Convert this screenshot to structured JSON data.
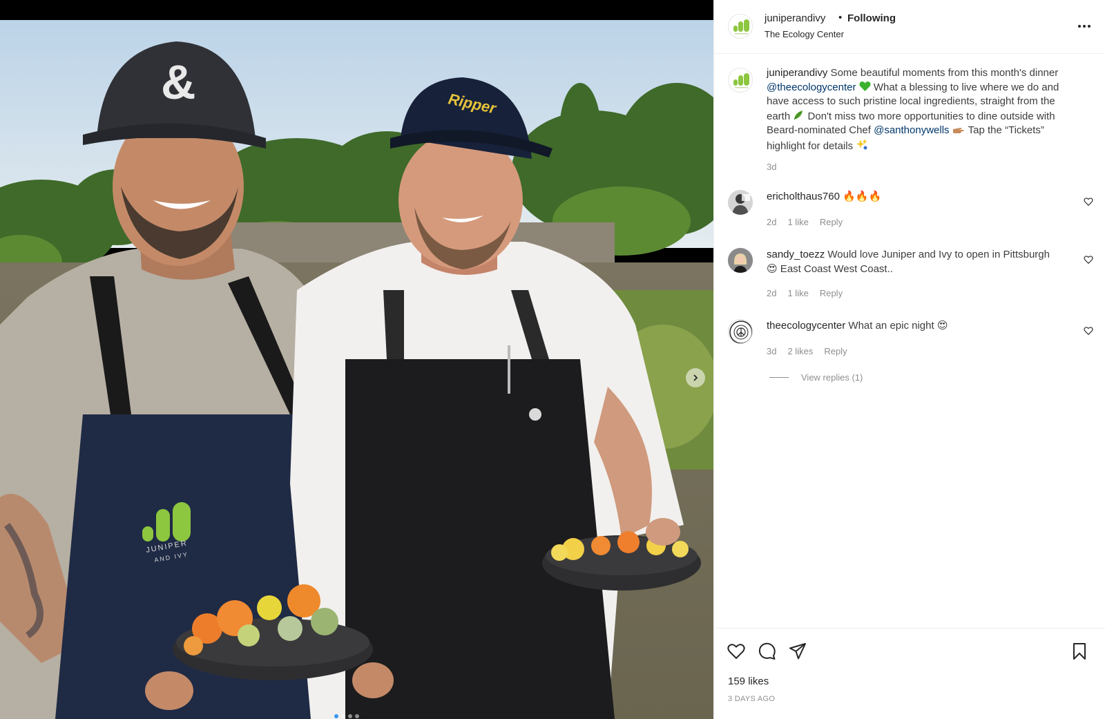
{
  "post": {
    "username": "juniperandivy",
    "separator": "•",
    "following_label": "Following",
    "location": "The Ecology Center",
    "more_icon": "more-horizontal-icon",
    "brand_color": "#8dc63f"
  },
  "photo": {
    "apron_logo_line1": "JUNIPER",
    "apron_logo_line2": "AND IVY",
    "cap_logo": "&",
    "cap2_text": "Ripper"
  },
  "caption": {
    "username": "juniperandivy",
    "text_1": " Some beautiful moments from this month's dinner ",
    "mention_1": "@theecologycenter",
    "text_2": " What a blessing to live where we do and have access to such pristine local ingredients, straight from the earth ",
    "text_3": " Don't miss two more opportunities to dine outside with Beard-nominated Chef ",
    "mention_2": "@santhonywells",
    "text_4": " Tap the “Tickets” highlight for details ",
    "age": "3d"
  },
  "comments": [
    {
      "username": "ericholthaus760",
      "text": "",
      "emoji": "🔥🔥🔥",
      "age": "2d",
      "likes": "1 like",
      "reply_label": "Reply"
    },
    {
      "username": "sandy_toezz",
      "text": " Would love Juniper and Ivy to open in Pittsburgh ",
      "emoji_before_text2": "😍",
      "text2": " East Coast West Coast..",
      "age": "2d",
      "likes": "1 like",
      "reply_label": "Reply"
    },
    {
      "username": "theecologycenter",
      "text": " What an epic night ",
      "emoji": "😍",
      "age": "3d",
      "likes": "2 likes",
      "reply_label": "Reply"
    }
  ],
  "view_replies_label": "View replies (1)",
  "footer": {
    "likes_count": "159 likes",
    "post_age": "3 DAYS AGO"
  }
}
